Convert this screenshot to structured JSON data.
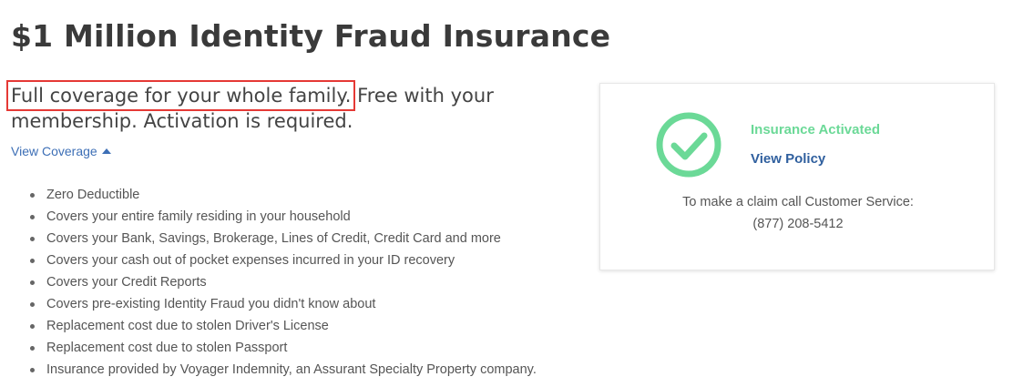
{
  "header": {
    "title": "$1 Million Identity Fraud Insurance"
  },
  "intro": {
    "highlighted": "Full coverage for your whole family.",
    "rest": " Free with your membership. Activation is required.",
    "highlight_color": "#e53935"
  },
  "coverage_toggle": {
    "label": "View Coverage",
    "icon": "caret-up-icon"
  },
  "features": [
    "Zero Deductible",
    "Covers your entire family residing in your household",
    "Covers your Bank, Savings, Brokerage, Lines of Credit, Credit Card and more",
    "Covers your cash out of pocket expenses incurred in your ID recovery",
    "Covers your Credit Reports",
    "Covers pre-existing Identity Fraud you didn't know about",
    "Replacement cost due to stolen Driver's License",
    "Replacement cost due to stolen Passport",
    "Insurance provided by Voyager Indemnity, an Assurant Specialty Property company."
  ],
  "status_card": {
    "icon": "check-circle-icon",
    "status": "Insurance Activated",
    "status_color": "#6bd997",
    "policy_link": "View Policy",
    "claim_text": "To make a claim call Customer Service:",
    "phone": "(877) 208-5412"
  }
}
